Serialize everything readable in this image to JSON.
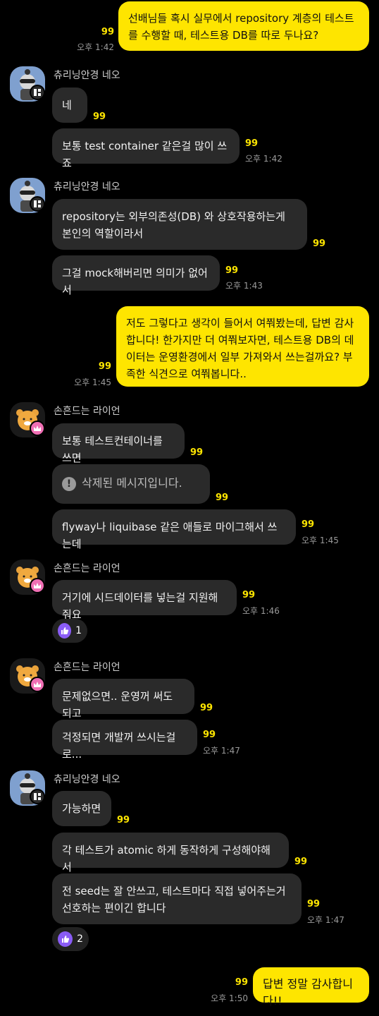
{
  "colors": {
    "my_bubble": "#FEE500",
    "other_bubble": "#2a2a2a",
    "unread": "#FEE500",
    "like": "#8a5cf6"
  },
  "messages": [
    {
      "text": "선배님들 혹시 실무에서 repository 계층의 테스트를 수행할 때, 테스트용 DB를 따로 두나요?",
      "count": "99",
      "time": "오후 1:42"
    },
    {
      "sender": "츄리닝안경 네오",
      "text": "네",
      "count": "99"
    },
    {
      "text": "보통 test container 같은걸 많이 쓰죠",
      "count": "99",
      "time": "오후 1:42"
    },
    {
      "sender": "츄리닝안경 네오",
      "text": "repository는 외부의존성(DB) 와 상호작용하는게 본인의 역할이라서",
      "count": "99"
    },
    {
      "text": "그걸 mock해버리면 의미가 없어서",
      "count": "99",
      "time": "오후 1:43"
    },
    {
      "text": "저도 그렇다고 생각이 들어서 여쭤봤는데, 답변 감사합니다! 한가지만 더 여쭤보자면, 테스트용 DB의 데이터는 운영환경에서 일부 가져와서 쓰는걸까요? 부족한 식견으로 여쭤봅니다..",
      "count": "99",
      "time": "오후 1:45"
    },
    {
      "sender": "손흔드는 라이언",
      "text": "보통 테스트컨테이너를 쓰면",
      "count": "99"
    },
    {
      "text": "삭제된 메시지입니다.",
      "count": "99"
    },
    {
      "text": "flyway나 liquibase 같은 애들로 마이그해서 쓰는데",
      "count": "99",
      "time": "오후 1:45"
    },
    {
      "sender": "손흔드는 라이언",
      "text": "거기에 시드데이터를 넣는걸 지원해줘요",
      "count": "99",
      "time": "오후 1:46",
      "reaction": "1"
    },
    {
      "sender": "손흔드는 라이언",
      "text": "문제없으면.. 운영꺼 써도 되고",
      "count": "99"
    },
    {
      "text": "걱정되면 개발꺼 쓰시는걸로...",
      "count": "99",
      "time": "오후 1:47"
    },
    {
      "sender": "츄리닝안경 네오",
      "text": "가능하면",
      "count": "99"
    },
    {
      "text": "각 테스트가 atomic 하게 동작하게 구성해야해서",
      "count": "99"
    },
    {
      "text": "전 seed는 잘 안쓰고, 테스트마다 직접 넣어주는거 선호하는 편이긴 합니다",
      "count": "99",
      "time": "오후 1:47",
      "reaction": "2"
    },
    {
      "text": "답변 정말 감사합니다!!",
      "count": "99",
      "time": "오후 1:50"
    }
  ]
}
